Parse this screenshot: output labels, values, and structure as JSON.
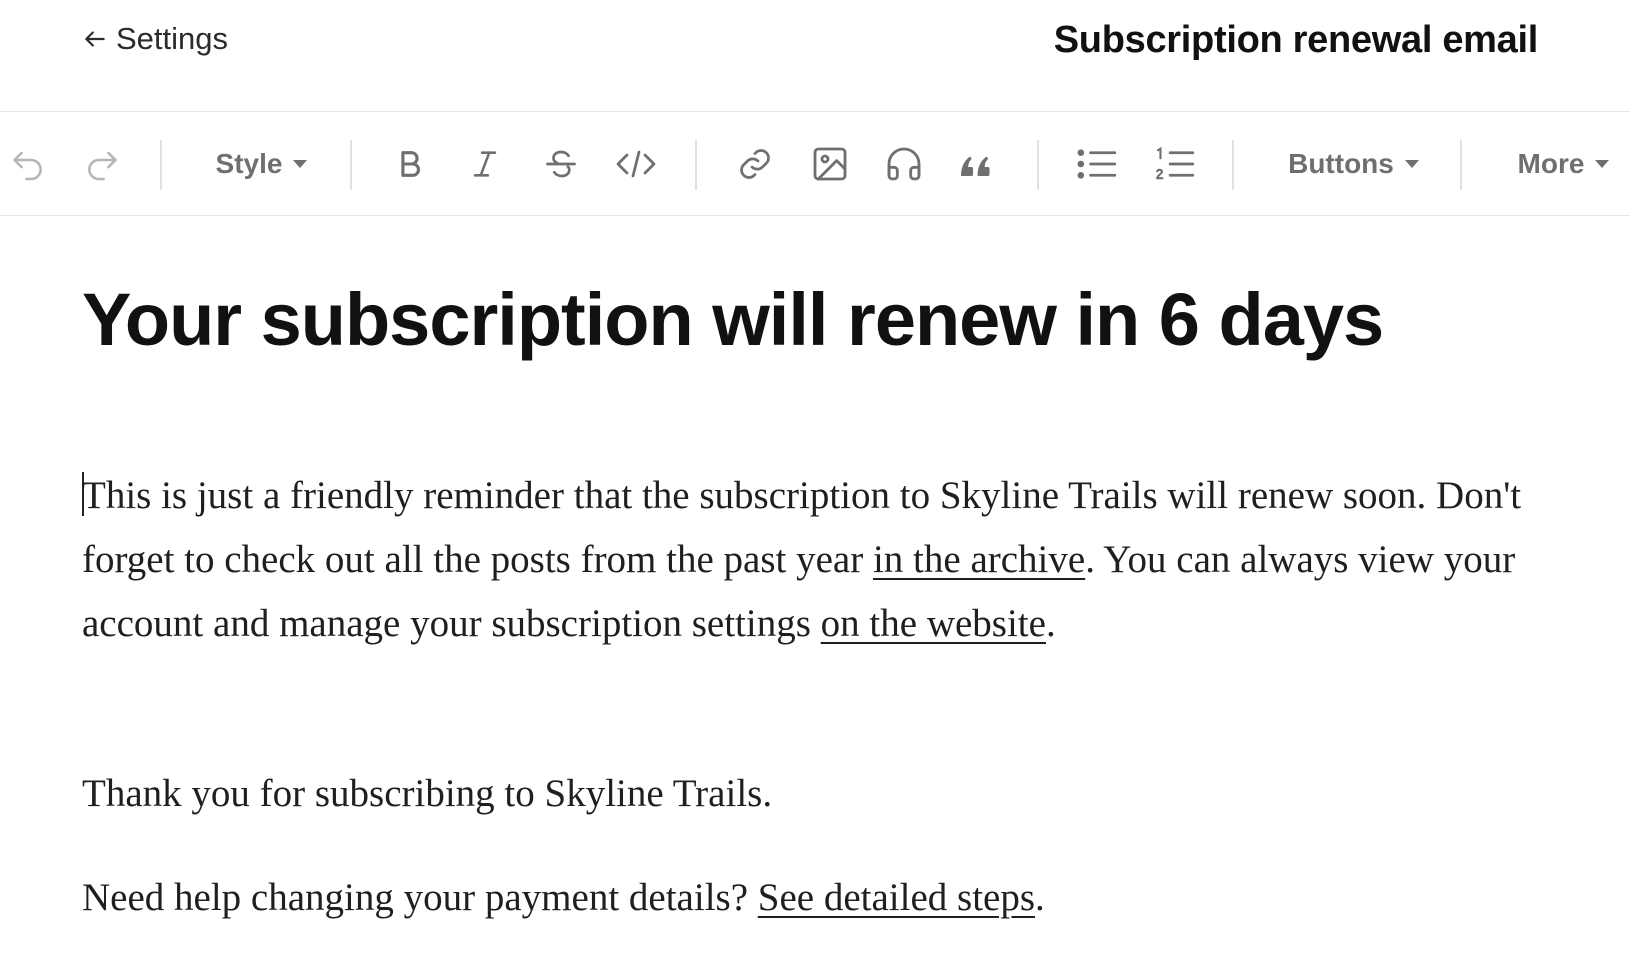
{
  "header": {
    "back_label": "Settings",
    "title": "Subscription renewal email"
  },
  "toolbar": {
    "undo_icon": "undo-icon",
    "redo_icon": "redo-icon",
    "style_label": "Style",
    "buttons_label": "Buttons",
    "more_label": "More",
    "icons": [
      "bold-icon",
      "italic-icon",
      "strikethrough-icon",
      "code-icon",
      "link-icon",
      "image-icon",
      "audio-icon",
      "quote-icon",
      "bullet-list-icon",
      "numbered-list-icon"
    ]
  },
  "content": {
    "headline": "Your subscription will renew in 6 days",
    "p1": {
      "t1": "This is just a friendly reminder that the subscription to Skyline Trails will renew soon. Don't forget to check out all the posts from the past year ",
      "link1": "in the archive",
      "t2": ". You can always view your  account and manage your subscription settings ",
      "link2": "on the website",
      "t3": "."
    },
    "p2": "Thank you for subscribing to Skyline Trails.",
    "p3": {
      "t1": "Need help changing your payment details? ",
      "link": "See detailed steps",
      "t2": "."
    }
  },
  "colors": {
    "text": "#1c1c1c",
    "toolbar_icon": "#6f6f6f",
    "toolbar_icon_disabled": "#b5b5b5",
    "divider": "#e2e2e2"
  }
}
